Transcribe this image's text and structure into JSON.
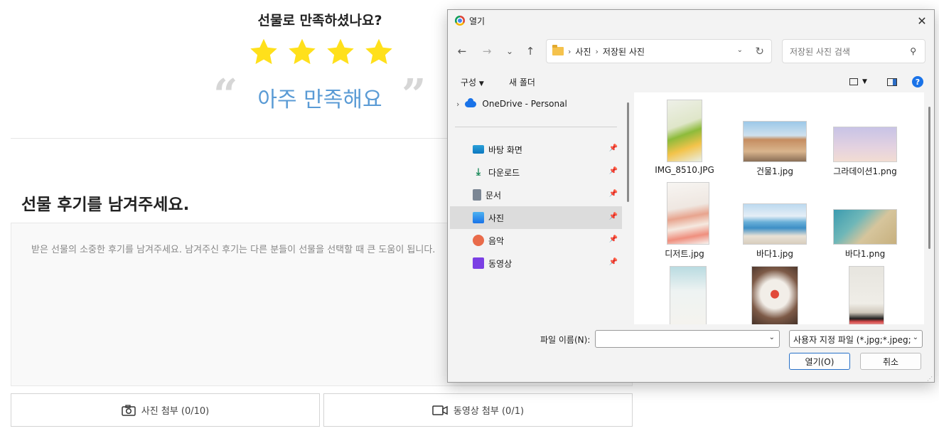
{
  "review": {
    "question": "선물로 만족하셨나요?",
    "star_count": 4,
    "star_color": "#FFE01B",
    "rating_text": "아주 만족해요",
    "open_quote": "“",
    "close_quote": "”",
    "section_title": "선물 후기를 남겨주세요.",
    "placeholder": "받은 선물의 소중한 후기를 남겨주세요. 남겨주신 후기는 다른 분들이 선물을 선택할 때 큰 도움이 됩니다.",
    "photo_button": "사진 첨부 (0/10)",
    "video_button": "동영상 첨부 (0/1)",
    "accent_color": "#5A9BD5"
  },
  "dialog": {
    "title": "열기",
    "close_glyph": "✕",
    "nav": {
      "back": "←",
      "forward": "→",
      "recent": "⌄",
      "up": "↑"
    },
    "breadcrumb": [
      "사진",
      "저장된 사진"
    ],
    "breadcrumb_sep": "›",
    "search_placeholder": "저장된 사진 검색",
    "commands": {
      "organize": "구성",
      "new_folder": "새 폴더",
      "help": "?"
    },
    "onedrive": "OneDrive - Personal",
    "quick_access": [
      {
        "label": "바탕 화면",
        "icon": "desktop-icon"
      },
      {
        "label": "다운로드",
        "icon": "download-icon"
      },
      {
        "label": "문서",
        "icon": "document-icon"
      },
      {
        "label": "사진",
        "icon": "pictures-icon",
        "selected": true
      },
      {
        "label": "음악",
        "icon": "music-icon"
      },
      {
        "label": "동영상",
        "icon": "video-icon"
      }
    ],
    "files": [
      {
        "name": "IMG_8510.JPG"
      },
      {
        "name": "건물1.jpg"
      },
      {
        "name": "그라데이션1.png"
      },
      {
        "name": "디저트.jpg"
      },
      {
        "name": "바다1.jpg"
      },
      {
        "name": "바다1.png"
      },
      {
        "name": ""
      },
      {
        "name": ""
      },
      {
        "name": ""
      }
    ],
    "filename_label": "파일 이름(N):",
    "filename_value": "",
    "filetype": "사용자 지정 파일 (*.jpg;*.jpeg;*",
    "open_button": "열기(O)",
    "cancel_button": "취소"
  }
}
